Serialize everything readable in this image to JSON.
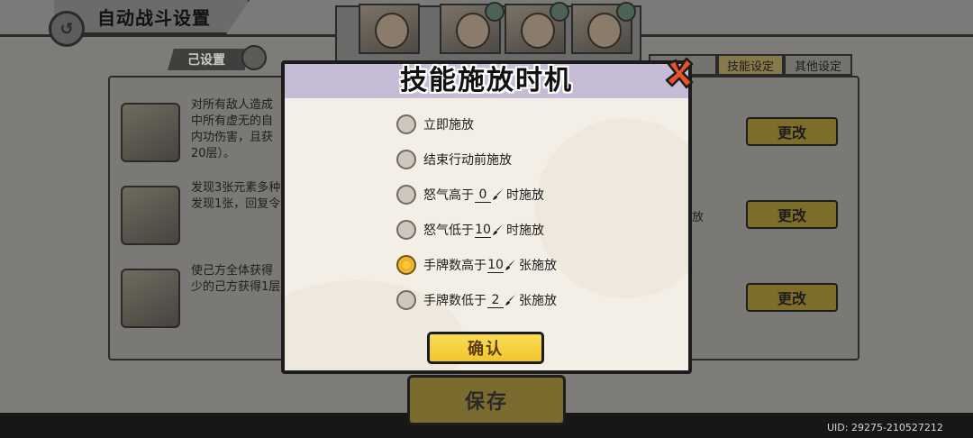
{
  "background": {
    "title": "自动战斗设置",
    "set_tag": "己设置",
    "tabs": [
      "技能设定",
      "其他设定"
    ],
    "skills": [
      {
        "desc": "对所有敌人造成中所有虚无的自内功伤害，且获20层）。"
      },
      {
        "desc": "发现3张元素多种发现1张，回复令"
      },
      {
        "desc": "使己方全体获得少的己方获得1层"
      }
    ],
    "change_label": "更改",
    "behind_fragment": "放",
    "save_label": "保存",
    "uid": "UID:  29275-210527212"
  },
  "modal": {
    "title": "技能施放时机",
    "options": [
      {
        "parts": [
          "立即施放"
        ],
        "checked": false
      },
      {
        "parts": [
          "结束行动前施放"
        ],
        "checked": false
      },
      {
        "prefix": "怒气高于",
        "value": "0",
        "suffix": "时施放",
        "checked": false
      },
      {
        "prefix": "怒气低于",
        "value": "10",
        "suffix": "时施放",
        "checked": false
      },
      {
        "prefix": "手牌数高于",
        "value": "10",
        "suffix": "张施放",
        "checked": true
      },
      {
        "prefix": "手牌数低于",
        "value": "2",
        "suffix": "张施放",
        "checked": false
      }
    ],
    "confirm_label": "确认"
  },
  "icons": [
    "back-icon",
    "close-icon",
    "brush-icon",
    "settings-icon"
  ],
  "colors": {
    "accent_yellow": "#f2c52a",
    "modal_header": "#c6bcd6",
    "close_red": "#e8542a"
  }
}
